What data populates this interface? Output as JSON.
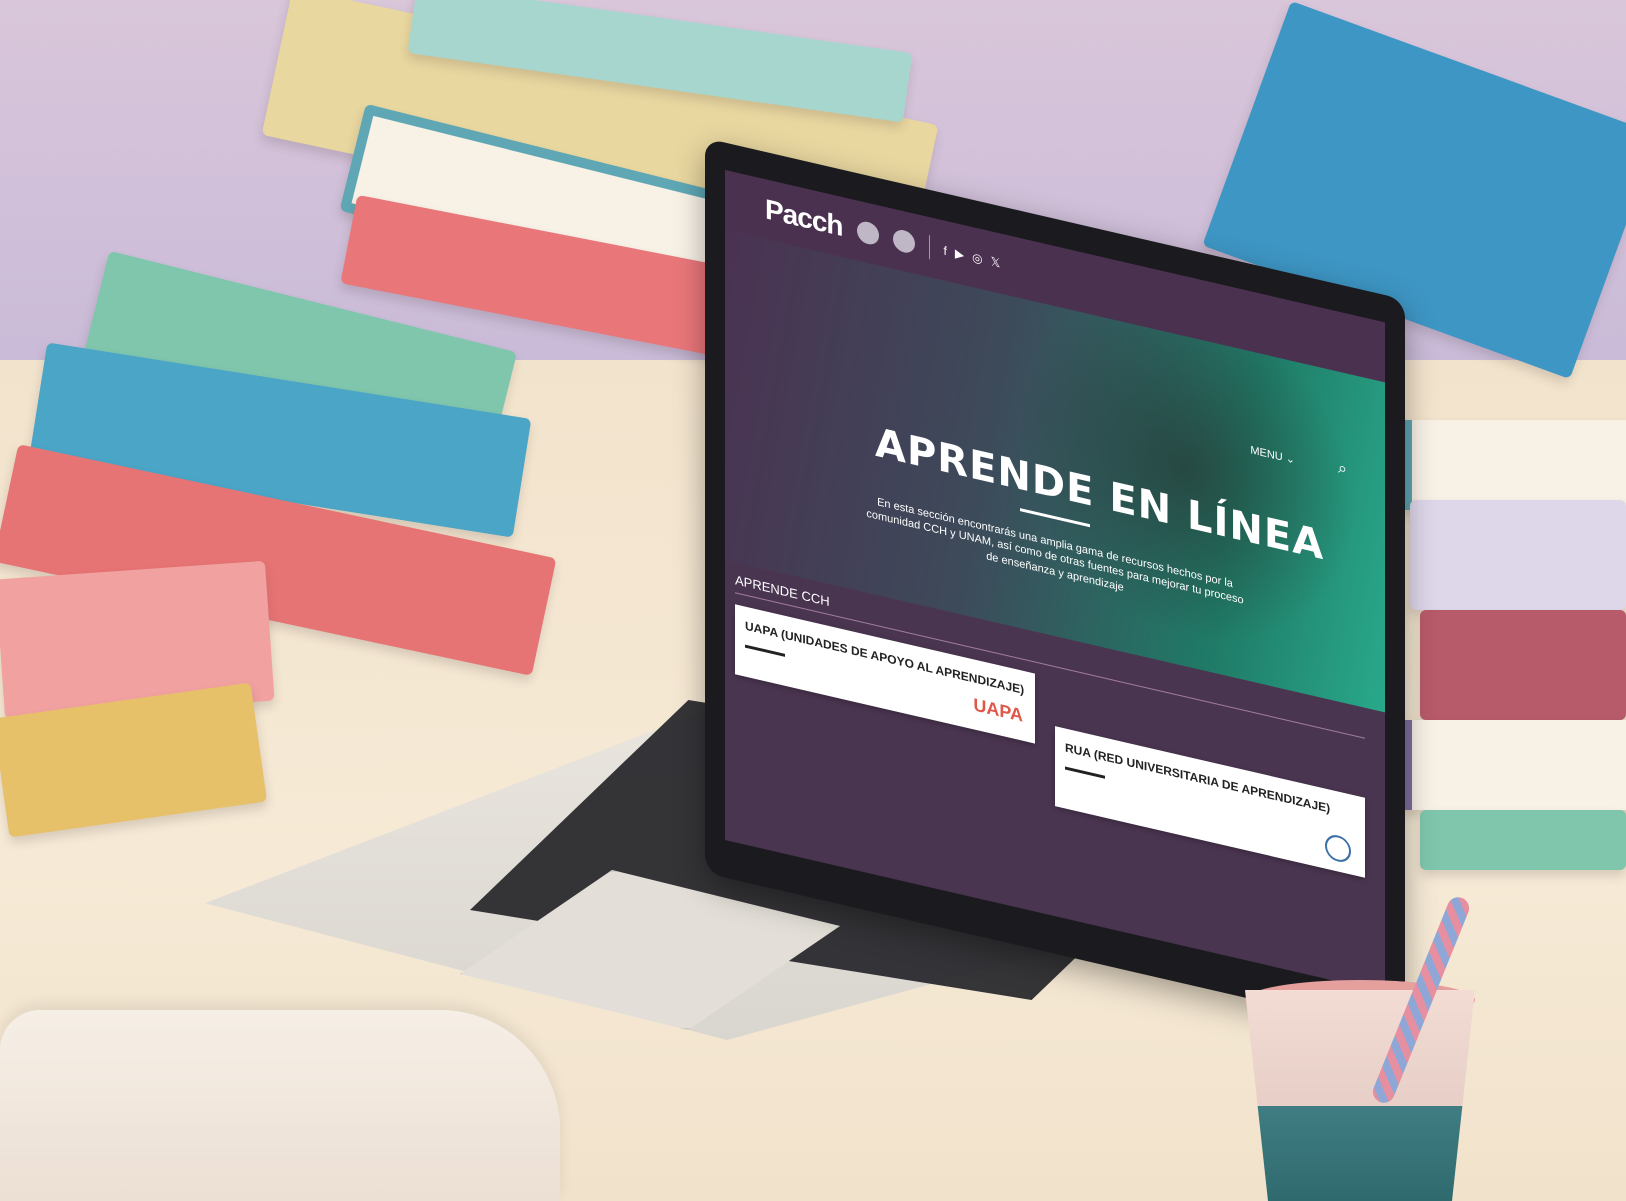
{
  "site": {
    "logo_text": "Pacch",
    "menu_label": "MENU ⌄",
    "hero": {
      "title": "APRENDE EN LÍNEA",
      "description": "En esta sección encontrarás una amplia gama de recursos hechos por la comunidad CCH y UNAM, así como de otras fuentes para mejorar tu proceso de enseñanza y aprendizaje"
    },
    "section_heading": "APRENDE CCH",
    "cards": [
      {
        "title": "UAPA (UNIDADES DE APOYO AL APRENDIZAJE)",
        "logo_text": "UAPA"
      },
      {
        "title": "RUA (RED UNIVERSITARIA DE APRENDIZAJE)"
      }
    ],
    "social_icons": [
      "facebook-icon",
      "youtube-icon",
      "instagram-icon",
      "x-icon"
    ]
  },
  "colors": {
    "topbar": "#4b3150",
    "hero_start": "#4a3252",
    "hero_end": "#29a98a",
    "uapa_logo": "#e0584a"
  }
}
